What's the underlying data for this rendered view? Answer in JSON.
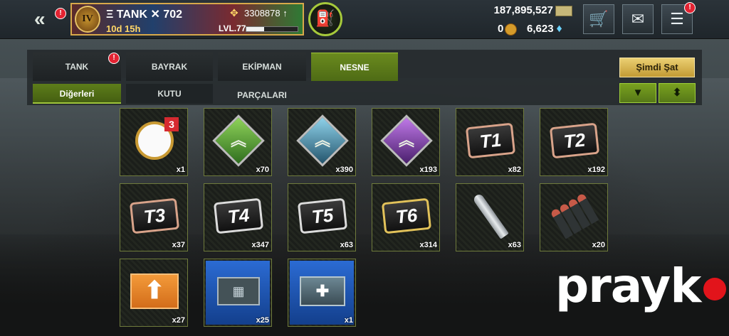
{
  "header": {
    "back_icon": "double-chevron-left",
    "rank": "IV",
    "player_name": "Ξ TANK ✕ 702",
    "timer": "10d 15h",
    "power_value": "3308878",
    "level": "LVL.77",
    "xp_progress": 0.35,
    "money": "187,895,527",
    "coins": "0",
    "gems": "6,623",
    "alert_badge": "!"
  },
  "tabs": [
    {
      "label": "TANK",
      "active": false,
      "alert": true
    },
    {
      "label": "BAYRAK",
      "active": false
    },
    {
      "label": "EKİPMAN PARÇALARI",
      "active": false
    },
    {
      "label": "NESNE",
      "active": true
    }
  ],
  "subtabs": [
    {
      "label": "Diğerleri",
      "active": true
    },
    {
      "label": "KUTU",
      "active": false
    }
  ],
  "actions": {
    "sell_label": "Şimdi Şat",
    "filter_icon": "funnel",
    "sort_icon": "up-down-arrows"
  },
  "items": [
    {
      "name": "stopwatch",
      "qty": "x1",
      "badge": "3"
    },
    {
      "name": "green-rank-chevron",
      "qty": "x70"
    },
    {
      "name": "blue-rank-chevron",
      "qty": "x390"
    },
    {
      "name": "purple-rank-chevron",
      "qty": "x193"
    },
    {
      "name": "ticket-t1",
      "label": "T1",
      "qty": "x82"
    },
    {
      "name": "ticket-t2",
      "label": "T2",
      "qty": "x192"
    },
    {
      "name": "ticket-t3",
      "label": "T3",
      "qty": "x37"
    },
    {
      "name": "ticket-t4",
      "label": "T4",
      "qty": "x347"
    },
    {
      "name": "ticket-t5",
      "label": "T5",
      "qty": "x63"
    },
    {
      "name": "ticket-t6",
      "label": "T6",
      "qty": "x314"
    },
    {
      "name": "missile",
      "qty": "x63"
    },
    {
      "name": "ammo-rounds",
      "qty": "x20"
    },
    {
      "name": "upgrade-arrow-box",
      "qty": "x27"
    },
    {
      "name": "radio-equipment",
      "qty": "x25"
    },
    {
      "name": "medkit-box",
      "qty": "x1"
    }
  ],
  "watermark": "prayk"
}
